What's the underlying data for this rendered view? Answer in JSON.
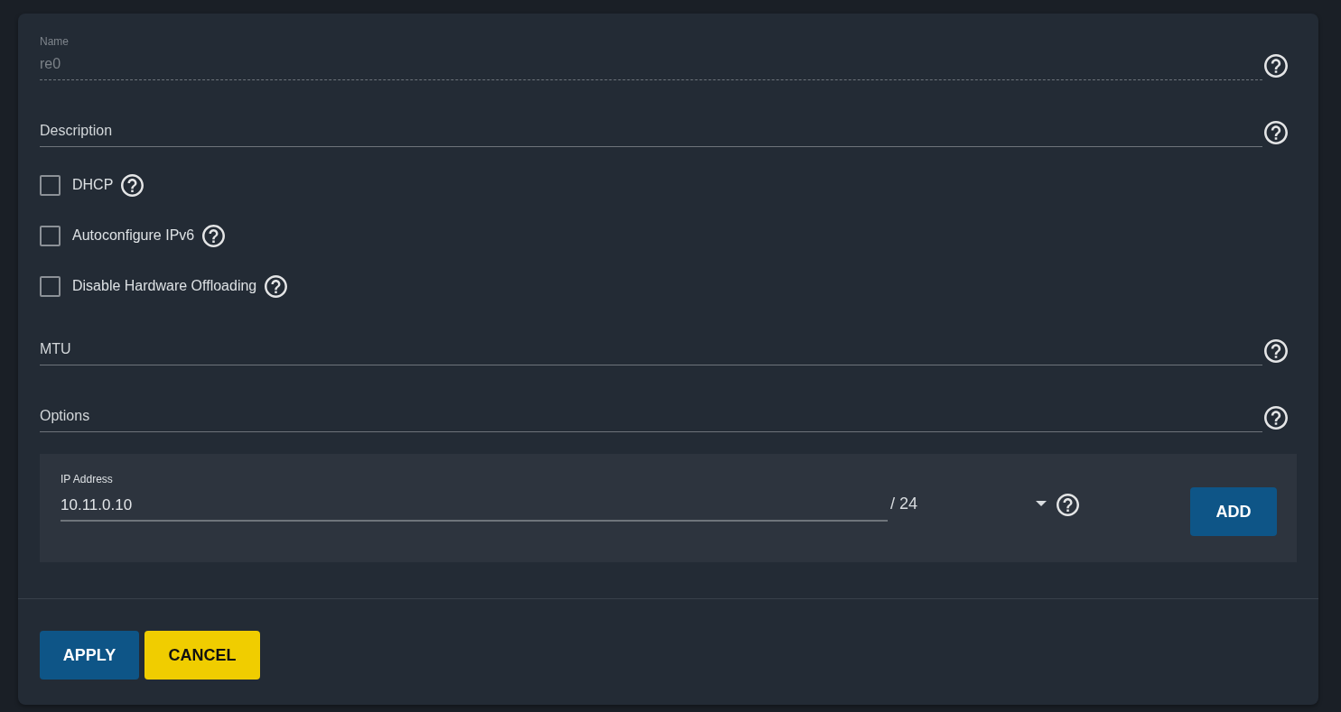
{
  "fields": [
    {
      "kind": "text",
      "label": "Name",
      "value": "re0",
      "disabled": true
    },
    {
      "kind": "text",
      "placeholder": "Description",
      "disabled": false
    },
    {
      "kind": "checkbox",
      "label": "DHCP",
      "checked": false,
      "disabled": false
    },
    {
      "kind": "checkbox",
      "label": "Autoconfigure IPv6",
      "checked": false,
      "disabled": false
    },
    {
      "kind": "checkbox",
      "label": "Disable Hardware Offloading",
      "checked": false,
      "disabled": false
    },
    {
      "kind": "text",
      "placeholder": "MTU",
      "disabled": false
    },
    {
      "kind": "text",
      "placeholder": "Options",
      "disabled": false
    }
  ],
  "ip_address": {
    "label": "IP Address",
    "value": "10.11.0.10",
    "netmask": "/ 24",
    "add_button": "ADD"
  },
  "buttons": [
    {
      "label": "APPLY",
      "kind": "primary"
    },
    {
      "label": "CANCEL",
      "kind": "warning"
    }
  ]
}
